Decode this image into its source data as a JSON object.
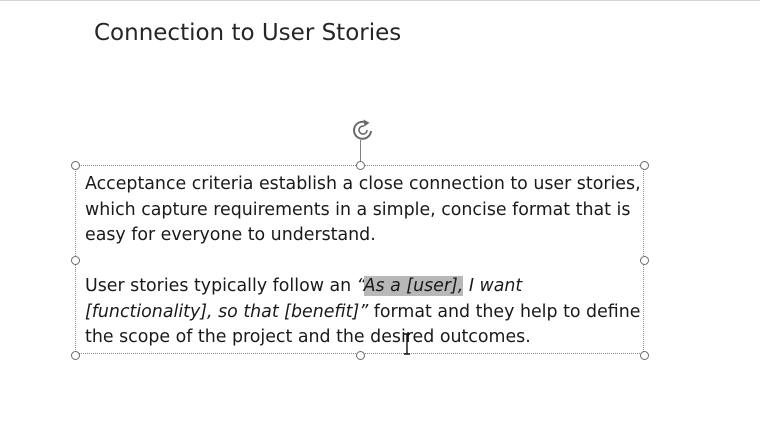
{
  "slide": {
    "title": "Connection to User Stories"
  },
  "textbox": {
    "paragraph1": "Acceptance criteria establish a close connection to user stories, which capture requirements in a simple, concise format that is easy for everyone to understand.",
    "paragraph2": {
      "before": "User stories typically follow an ",
      "quote_open": "“",
      "selected": "As a [user],",
      "italic_rest": " I want [functionality], so that [benefit]”",
      "after": " format and they help to define the scope of the project and the desired outcomes."
    }
  },
  "icons": {
    "rotate": "rotate-handle-icon",
    "cursor": "text-cursor-icon"
  },
  "colors": {
    "selection": "#b8b8b8",
    "handle_border": "#6a6a6a",
    "frame": "#8a8a8a"
  }
}
